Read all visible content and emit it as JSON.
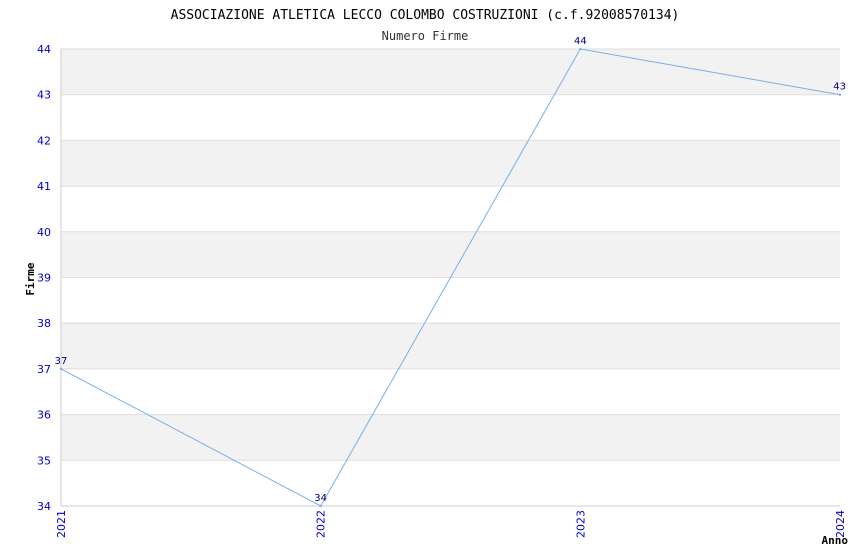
{
  "chart_data": {
    "type": "line",
    "title": "ASSOCIAZIONE ATLETICA LECCO COLOMBO COSTRUZIONI (c.f.92008570134)",
    "subtitle": "Numero Firme",
    "xlabel": "Anno",
    "ylabel": "Firme",
    "categories": [
      "2021",
      "2022",
      "2023",
      "2024"
    ],
    "series": [
      {
        "values": [
          37,
          34,
          44,
          43
        ]
      }
    ],
    "ylim": [
      34,
      44
    ],
    "yticks": [
      "34",
      "35",
      "36",
      "37",
      "38",
      "39",
      "40",
      "41",
      "42",
      "43",
      "44"
    ],
    "data_labels": [
      "37",
      "34",
      "44",
      "43"
    ],
    "grid": true,
    "legend": "none",
    "colors": {
      "line": "#7aafe8",
      "tick_text": "#0000cc",
      "data_label": "#000080",
      "band_alt": "#f2f2f2",
      "grid": "#dddddd"
    }
  }
}
